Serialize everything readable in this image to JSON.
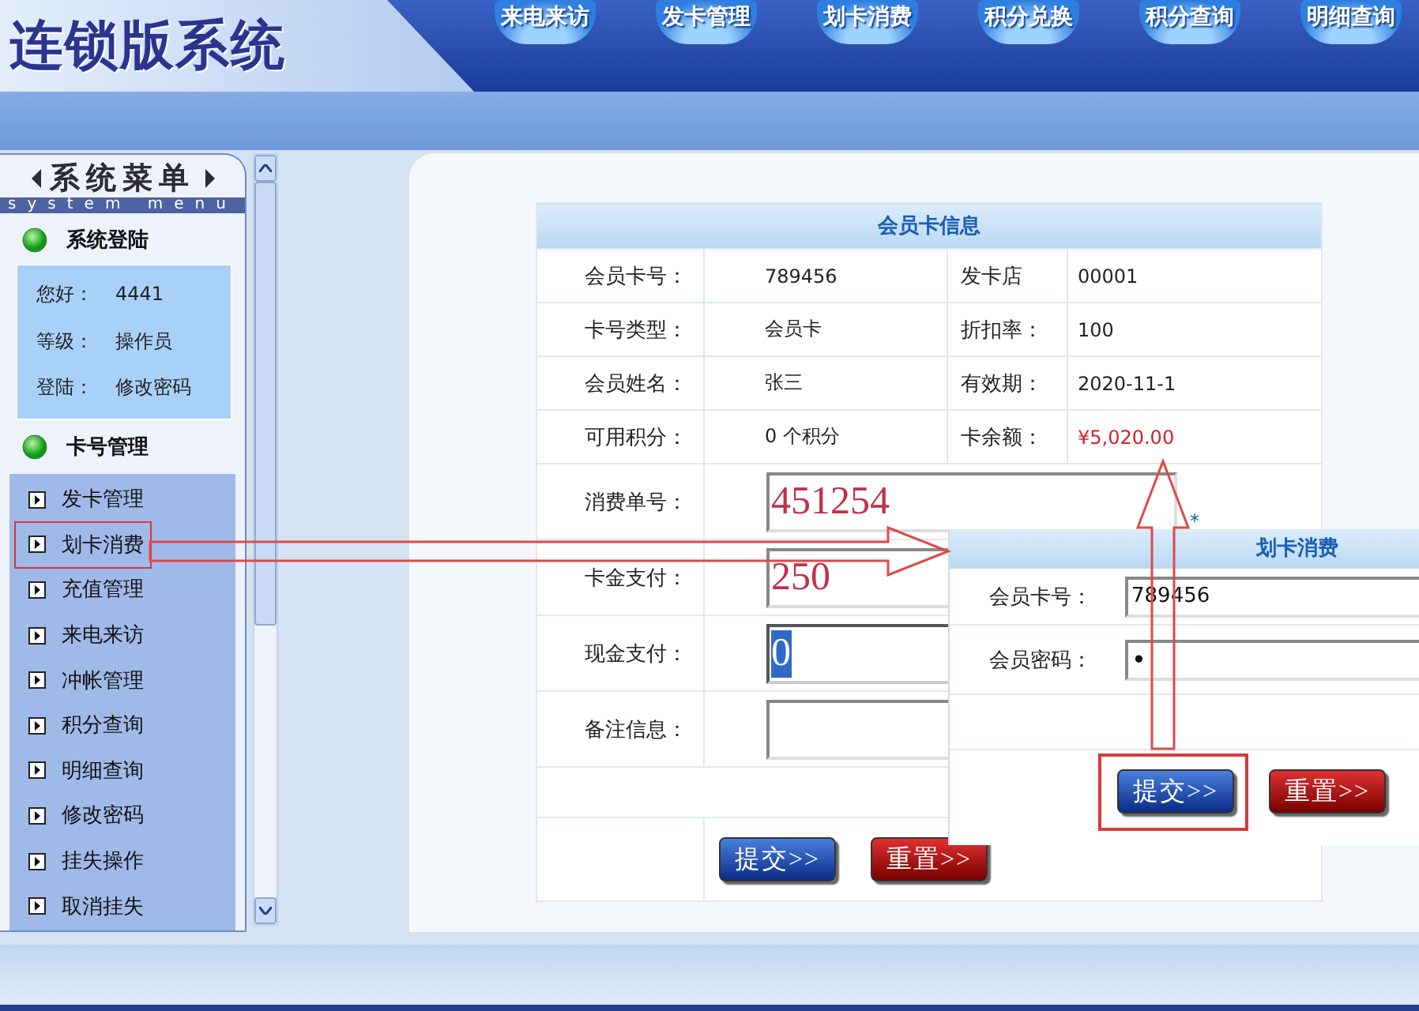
{
  "header": {
    "title": "连锁版系统",
    "nav": [
      {
        "label": "来电来访"
      },
      {
        "label": "发卡管理"
      },
      {
        "label": "划卡消费"
      },
      {
        "label": "积分兑换"
      },
      {
        "label": "积分查询"
      },
      {
        "label": "明细查询"
      }
    ]
  },
  "sidebar": {
    "title": "系统菜单",
    "subtitle": "system menu",
    "sections": [
      {
        "title": "系统登陆",
        "kind": "info",
        "rows": [
          {
            "label": "您好：",
            "value": "4441"
          },
          {
            "label": "等级：",
            "value": "操作员"
          },
          {
            "label": "登陆：",
            "value": "修改密码"
          }
        ]
      },
      {
        "title": "卡号管理",
        "kind": "links",
        "items": [
          {
            "label": "发卡管理",
            "selected": false
          },
          {
            "label": "划卡消费",
            "selected": true
          },
          {
            "label": "充值管理",
            "selected": false
          },
          {
            "label": "来电来访",
            "selected": false
          },
          {
            "label": "冲帐管理",
            "selected": false
          },
          {
            "label": "积分查询",
            "selected": false
          },
          {
            "label": "明细查询",
            "selected": false
          },
          {
            "label": "修改密码",
            "selected": false
          },
          {
            "label": "挂失操作",
            "selected": false
          },
          {
            "label": "取消挂失",
            "selected": false
          }
        ]
      }
    ]
  },
  "card_info": {
    "title": "会员卡信息",
    "rows": [
      [
        {
          "text": "会员卡号：",
          "kind": "label"
        },
        {
          "text": "789456",
          "kind": "value"
        },
        {
          "text": "发卡店",
          "kind": "label2"
        },
        {
          "text": "00001",
          "kind": "value"
        }
      ],
      [
        {
          "text": "卡号类型：",
          "kind": "label"
        },
        {
          "text": "会员卡",
          "kind": "value"
        },
        {
          "text": "折扣率：",
          "kind": "label2"
        },
        {
          "text": "100",
          "kind": "value"
        }
      ],
      [
        {
          "text": "会员姓名：",
          "kind": "label"
        },
        {
          "text": "张三",
          "kind": "value"
        },
        {
          "text": "有效期：",
          "kind": "label2"
        },
        {
          "text": "2020-11-1",
          "kind": "value"
        }
      ],
      [
        {
          "text": "可用积分：",
          "kind": "label"
        },
        {
          "text": "0 个积分",
          "kind": "value"
        },
        {
          "text": "卡余额：",
          "kind": "label2"
        },
        {
          "text": "¥5,020.00",
          "kind": "money"
        }
      ]
    ]
  },
  "form": {
    "fields": [
      {
        "label": "消费单号：",
        "value": "451254",
        "selected": false,
        "marker": "*"
      },
      {
        "label": "卡金支付：",
        "value": "250",
        "selected": false
      },
      {
        "label": "现金支付：",
        "value": "0",
        "selected": true
      },
      {
        "label": "备注信息：",
        "selected": false
      }
    ],
    "buttons": [
      {
        "label": "提交>>",
        "kind": "submit"
      },
      {
        "label": "重置>>",
        "kind": "reset"
      }
    ]
  },
  "dialog": {
    "title": "划卡消费",
    "fields": [
      {
        "label": "会员卡号：",
        "value": "789456",
        "kind": "text"
      },
      {
        "label": "会员密码：",
        "value": "•",
        "kind": "password"
      }
    ],
    "buttons": [
      {
        "label": "提交>>",
        "kind": "submit",
        "highlighted": true
      },
      {
        "label": "重置>>",
        "kind": "reset",
        "highlighted": false
      }
    ]
  }
}
